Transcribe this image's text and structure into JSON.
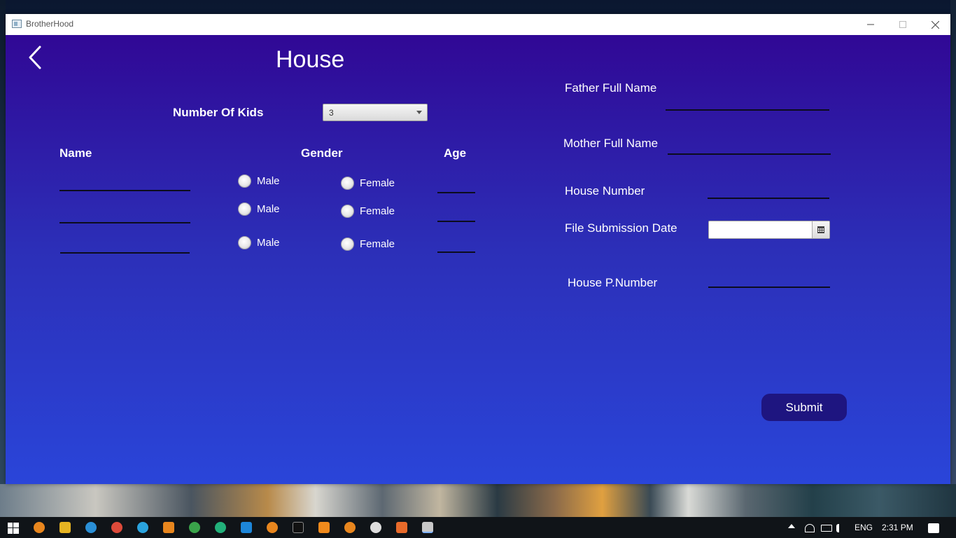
{
  "window": {
    "title": "BrotherHood"
  },
  "page": {
    "title": "House"
  },
  "kids": {
    "label": "Number Of Kids",
    "selected": "3"
  },
  "table": {
    "headers": {
      "name": "Name",
      "gender": "Gender",
      "age": "Age"
    },
    "rows": [
      {
        "male": "Male",
        "female": "Female"
      },
      {
        "male": "Male",
        "female": "Female"
      },
      {
        "male": "Male",
        "female": "Female"
      }
    ]
  },
  "form": {
    "father_label": "Father Full Name",
    "mother_label": "Mother Full Name",
    "house_number_label": "House Number",
    "date_label": "File Submission Date",
    "phone_label": "House P.Number",
    "submit_label": "Submit"
  },
  "taskbar": {
    "language": "ENG",
    "time": "2:31 PM"
  },
  "colors": {
    "gradient_top": "#300895",
    "gradient_bottom": "#2a45d9",
    "button": "#1e1580"
  },
  "icons": [
    "back-arrow-icon",
    "calendar-icon",
    "dropdown-caret-icon",
    "windows-start-icon"
  ]
}
